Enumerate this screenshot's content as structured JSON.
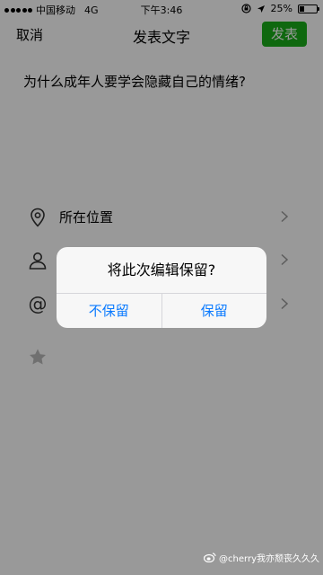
{
  "status_bar": {
    "carrier": "中国移动",
    "network": "4G",
    "time": "下午3:46",
    "battery": "25%",
    "battery_level": 0.25,
    "icons": [
      "lock-rotation-icon",
      "location-arrow-icon"
    ]
  },
  "nav": {
    "cancel_label": "取消",
    "title": "发表文字",
    "publish_label": "发表",
    "publish_color": "#1aad19"
  },
  "post": {
    "text": "为什么成年人要学会隐藏自己的情绪?"
  },
  "options": [
    {
      "icon": "location-pin-icon",
      "label": "所在位置"
    },
    {
      "icon": "person-icon",
      "label": ""
    },
    {
      "icon": "at-icon",
      "label": ""
    },
    {
      "icon": "star-badge-icon",
      "label": ""
    }
  ],
  "dialog": {
    "message": "将此次编辑保留?",
    "discard_label": "不保留",
    "keep_label": "保留",
    "button_color": "#0a7aff"
  },
  "watermark": {
    "text": "@cherry我亦颓丧久久久",
    "icon": "weibo-icon"
  }
}
